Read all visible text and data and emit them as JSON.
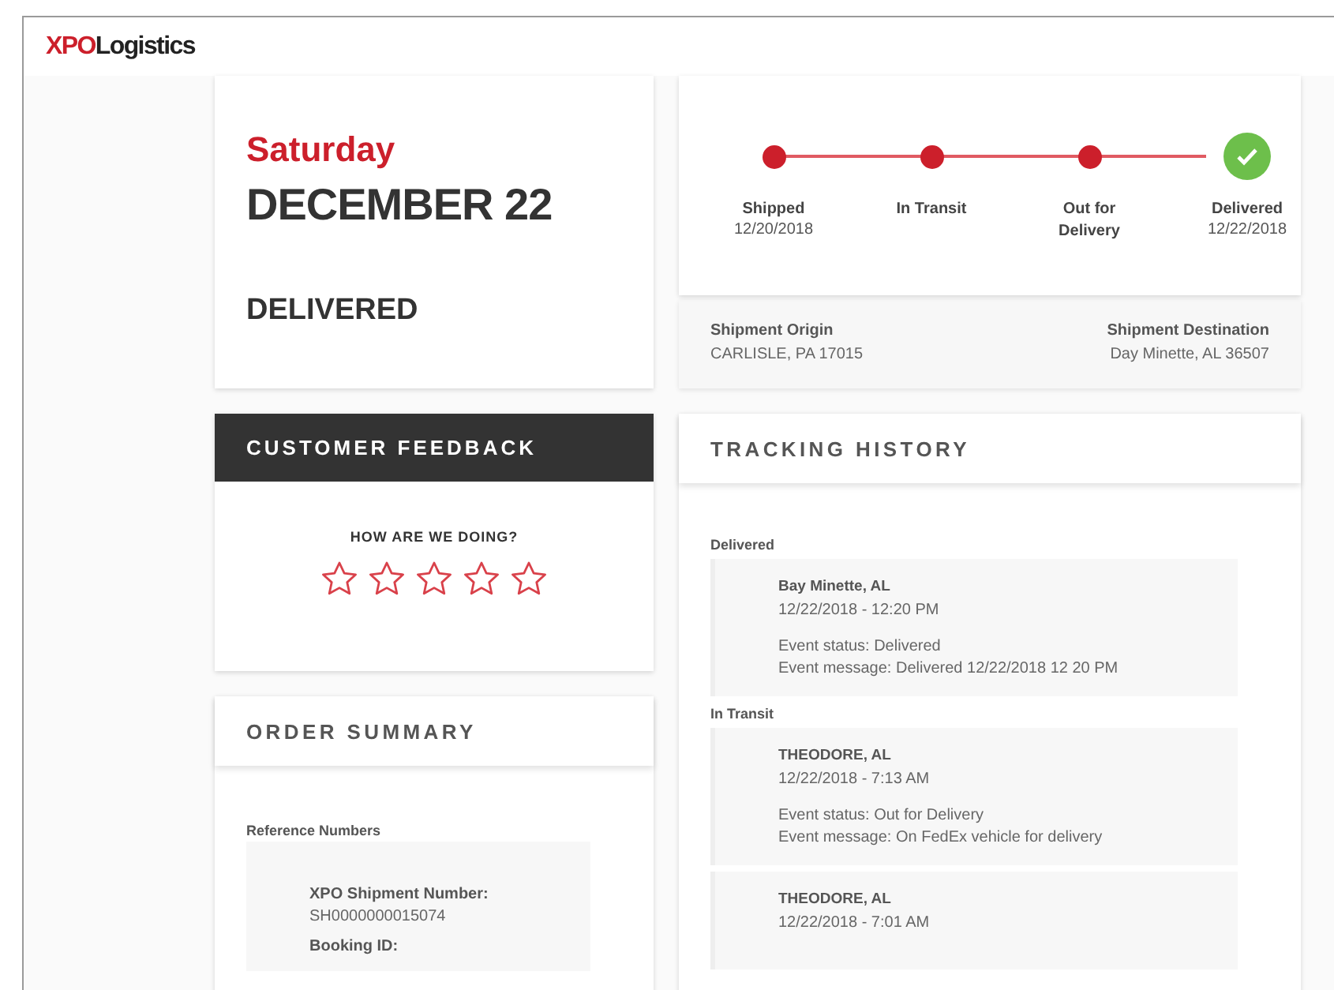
{
  "brand": {
    "mark": "XPO",
    "name": "Logistics"
  },
  "delivery": {
    "weekday": "Saturday",
    "date": "DECEMBER 22",
    "status": "DELIVERED"
  },
  "progress": [
    {
      "label": "Shipped",
      "date": "12/20/2018",
      "kind": "dot"
    },
    {
      "label": "In Transit",
      "kind": "dot"
    },
    {
      "label": "Out for Delivery",
      "kind": "dot"
    },
    {
      "label": "Delivered",
      "date": "12/22/2018",
      "kind": "check"
    }
  ],
  "origin": {
    "label": "Shipment Origin",
    "value": "CARLISLE, PA 17015"
  },
  "destination": {
    "label": "Shipment Destination",
    "value": "Day Minette, AL 36507"
  },
  "feedback": {
    "title": "CUSTOMER FEEDBACK",
    "question": "HOW ARE WE DOING?",
    "stars": 0
  },
  "order_summary": {
    "title": "ORDER SUMMARY",
    "section": "Reference Numbers",
    "fields": [
      {
        "label": "XPO Shipment Number:",
        "value": "SH0000000015074"
      },
      {
        "label": "Booking ID:"
      }
    ]
  },
  "tracking_history": {
    "title": "TRACKING HISTORY",
    "groups": [
      {
        "status": "Delivered",
        "events": [
          {
            "place": "Bay Minette, AL",
            "time": "12/22/2018 - 12:20 PM",
            "lines": [
              "Event status: Delivered",
              "Event message: Delivered 12/22/2018 12 20 PM"
            ]
          }
        ]
      },
      {
        "status": "In Transit",
        "events": [
          {
            "place": "THEODORE, AL",
            "time": "12/22/2018 - 7:13 AM",
            "lines": [
              "Event status: Out for Delivery",
              "Event message: On FedEx vehicle for delivery"
            ]
          },
          {
            "place": "THEODORE, AL",
            "time": "12/22/2018 - 7:01 AM"
          }
        ]
      }
    ]
  }
}
